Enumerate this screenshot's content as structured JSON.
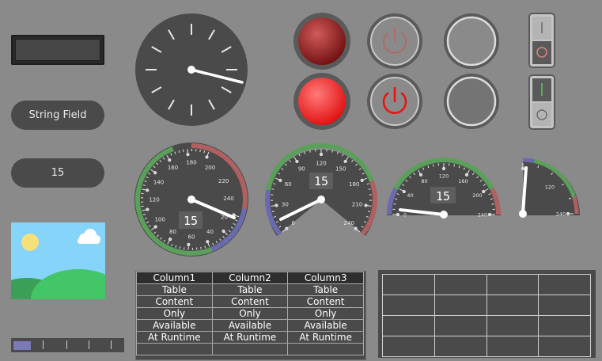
{
  "string_field": {
    "text": "String Field"
  },
  "numeric_field": {
    "value": "15"
  },
  "slider": {
    "level": 0.16
  },
  "gauge_large": {
    "labels": [
      "20",
      "40",
      "60",
      "80",
      "100",
      "120",
      "140",
      "160",
      "180",
      "200",
      "220",
      "240"
    ],
    "readout": "15"
  },
  "gauge_half": {
    "labels": [
      "0",
      "30",
      "60",
      "90",
      "120",
      "150",
      "180",
      "210",
      "240"
    ],
    "readout": "15"
  },
  "gauge_small": {
    "labels": [
      "0",
      "40",
      "80",
      "120",
      "160",
      "200",
      "240"
    ],
    "readout": "15"
  },
  "gauge_quarter": {
    "labels": [
      "120",
      "240"
    ]
  },
  "table": {
    "headers": [
      "Column1",
      "Column2",
      "Column3"
    ],
    "rows": [
      [
        "Table",
        "Table",
        "Table"
      ],
      [
        "Content",
        "Content",
        "Content"
      ],
      [
        "Only",
        "Only",
        "Only"
      ],
      [
        "Available",
        "Available",
        "Available"
      ],
      [
        "At Runtime",
        "At Runtime",
        "At Runtime"
      ],
      [
        "",
        "",
        ""
      ]
    ]
  },
  "colors": {
    "green": "#5aa05a",
    "red": "#b06060",
    "blue": "#6a6ab0",
    "led_red": "#ff2a2a",
    "dark_red": "#8a1010"
  }
}
